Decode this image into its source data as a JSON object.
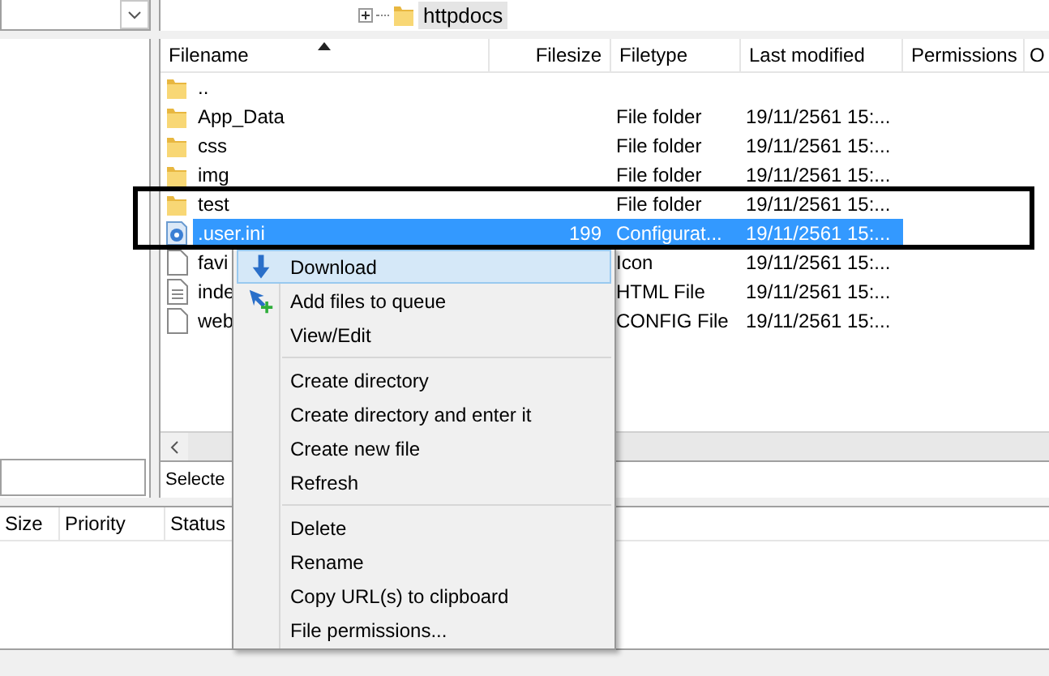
{
  "remote_tree": {
    "items": [
      {
        "label": "httpdocs",
        "expanded": false,
        "selected": true
      }
    ]
  },
  "file_list": {
    "columns": [
      {
        "label": "Filename",
        "sorted": true
      },
      {
        "label": "Filesize",
        "sorted": false
      },
      {
        "label": "Filetype",
        "sorted": false
      },
      {
        "label": "Last modified",
        "sorted": false
      },
      {
        "label": "Permissions",
        "sorted": false
      },
      {
        "label": "O",
        "sorted": false
      }
    ],
    "rows": [
      {
        "kind": "folder",
        "name": "..",
        "selected": false
      },
      {
        "kind": "folder",
        "name": "App_Data",
        "type": "File folder",
        "modified": "19/11/2561 15:...",
        "selected": false
      },
      {
        "kind": "folder",
        "name": "css",
        "type": "File folder",
        "modified": "19/11/2561 15:...",
        "selected": false
      },
      {
        "kind": "folder",
        "name": "img",
        "type": "File folder",
        "modified": "19/11/2561 15:...",
        "selected": false
      },
      {
        "kind": "folder",
        "name": "test",
        "type": "File folder",
        "modified": "19/11/2561 15:...",
        "selected": false
      },
      {
        "kind": "settings-file",
        "name": ".user.ini",
        "size": "199",
        "type": "Configurat...",
        "modified": "19/11/2561 15:...",
        "selected": true
      },
      {
        "kind": "file",
        "name": "favi",
        "type": "Icon",
        "modified": "19/11/2561 15:...",
        "selected": false
      },
      {
        "kind": "text-file",
        "name": "inde",
        "type": "HTML File",
        "modified": "19/11/2561 15:...",
        "selected": false
      },
      {
        "kind": "file",
        "name": "web",
        "type": "CONFIG File",
        "modified": "19/11/2561 15:...",
        "selected": false
      }
    ],
    "status": "Selecte"
  },
  "queue": {
    "columns": [
      "Size",
      "Priority",
      "Status"
    ]
  },
  "context_menu": {
    "items": [
      {
        "kind": "download",
        "label": "Download",
        "selected": true
      },
      {
        "kind": "queue",
        "label": "Add files to queue",
        "selected": false
      },
      {
        "kind": "item",
        "label": "View/Edit",
        "selected": false
      },
      {
        "kind": "separator"
      },
      {
        "kind": "item",
        "label": "Create directory",
        "selected": false
      },
      {
        "kind": "item",
        "label": "Create directory and enter it",
        "selected": false
      },
      {
        "kind": "item",
        "label": "Create new file",
        "selected": false
      },
      {
        "kind": "item",
        "label": "Refresh",
        "selected": false
      },
      {
        "kind": "separator"
      },
      {
        "kind": "item",
        "label": "Delete",
        "selected": false
      },
      {
        "kind": "item",
        "label": "Rename",
        "selected": false
      },
      {
        "kind": "item",
        "label": "Copy URL(s) to clipboard",
        "selected": false
      },
      {
        "kind": "item",
        "label": "File permissions...",
        "selected": false
      }
    ]
  }
}
